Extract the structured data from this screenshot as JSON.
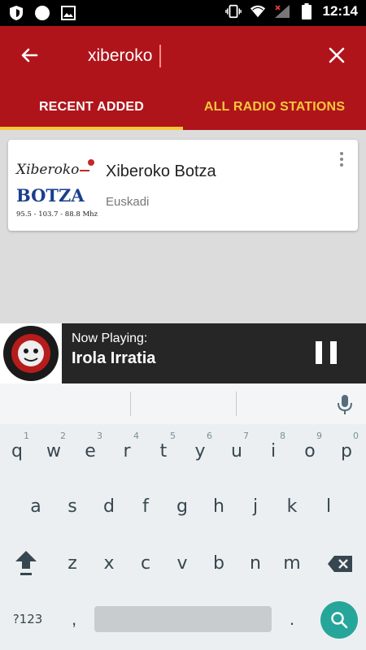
{
  "status_bar": {
    "time": "12:14",
    "left_icons": [
      "shield-icon",
      "circle-icon",
      "image-icon"
    ],
    "right_icons": [
      "vibrate-icon",
      "wifi-icon",
      "signal-icon",
      "battery-icon"
    ]
  },
  "search": {
    "value": "xiberoko",
    "back_icon": "arrow-left-icon",
    "clear_icon": "close-icon"
  },
  "tabs": [
    {
      "label": "RECENT ADDED",
      "active": true
    },
    {
      "label": "ALL RADIO STATIONS",
      "active": false
    }
  ],
  "results": [
    {
      "name": "Xiberoko Botza",
      "region": "Euskadi",
      "logo_text": {
        "top": "Xiberoko",
        "main": "BOTZA",
        "freq": "95.5 - 103.7 - 88.8 Mhz"
      }
    }
  ],
  "player": {
    "label": "Now Playing:",
    "title": "Irola Irratia",
    "logo_text": "IROLA IRRATIA 107.5 FM"
  },
  "keyboard": {
    "row1": [
      {
        "key": "q",
        "hint": "1"
      },
      {
        "key": "w",
        "hint": "2"
      },
      {
        "key": "e",
        "hint": "3"
      },
      {
        "key": "r",
        "hint": "4"
      },
      {
        "key": "t",
        "hint": "5"
      },
      {
        "key": "y",
        "hint": "6"
      },
      {
        "key": "u",
        "hint": "7"
      },
      {
        "key": "i",
        "hint": "8"
      },
      {
        "key": "o",
        "hint": "9"
      },
      {
        "key": "p",
        "hint": "0"
      }
    ],
    "row2": [
      "a",
      "s",
      "d",
      "f",
      "g",
      "h",
      "j",
      "k",
      "l"
    ],
    "row3": [
      "z",
      "x",
      "c",
      "v",
      "b",
      "n",
      "m"
    ],
    "symbols_label": "?123",
    "comma": ",",
    "period": "."
  },
  "colors": {
    "app_bar": "#b0141b",
    "accent": "#f7c83a",
    "player_bg": "#262626",
    "enter_key": "#26a69a"
  }
}
